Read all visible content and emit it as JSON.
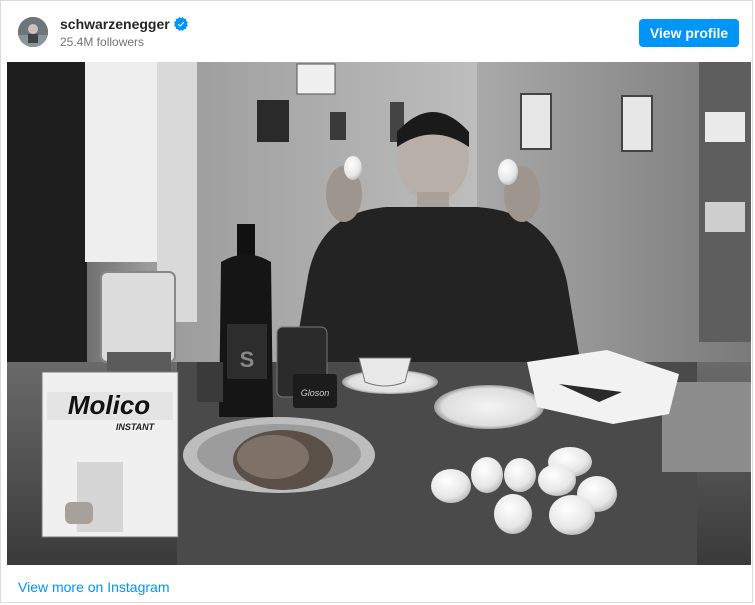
{
  "post": {
    "username": "schwarzenegger",
    "followers": "25.4M followers",
    "verified": true,
    "view_profile_label": "View profile",
    "view_more_label": "View more on Instagram"
  },
  "photo": {
    "description_icon": "photo-image",
    "box_brand": "Molico",
    "box_sub": "INSTANT",
    "can_label": "Gloson",
    "bottle_label": "S"
  },
  "colors": {
    "accent": "#0095f6",
    "username": "#262626",
    "secondary": "#737373",
    "border": "#dbdbdb"
  }
}
